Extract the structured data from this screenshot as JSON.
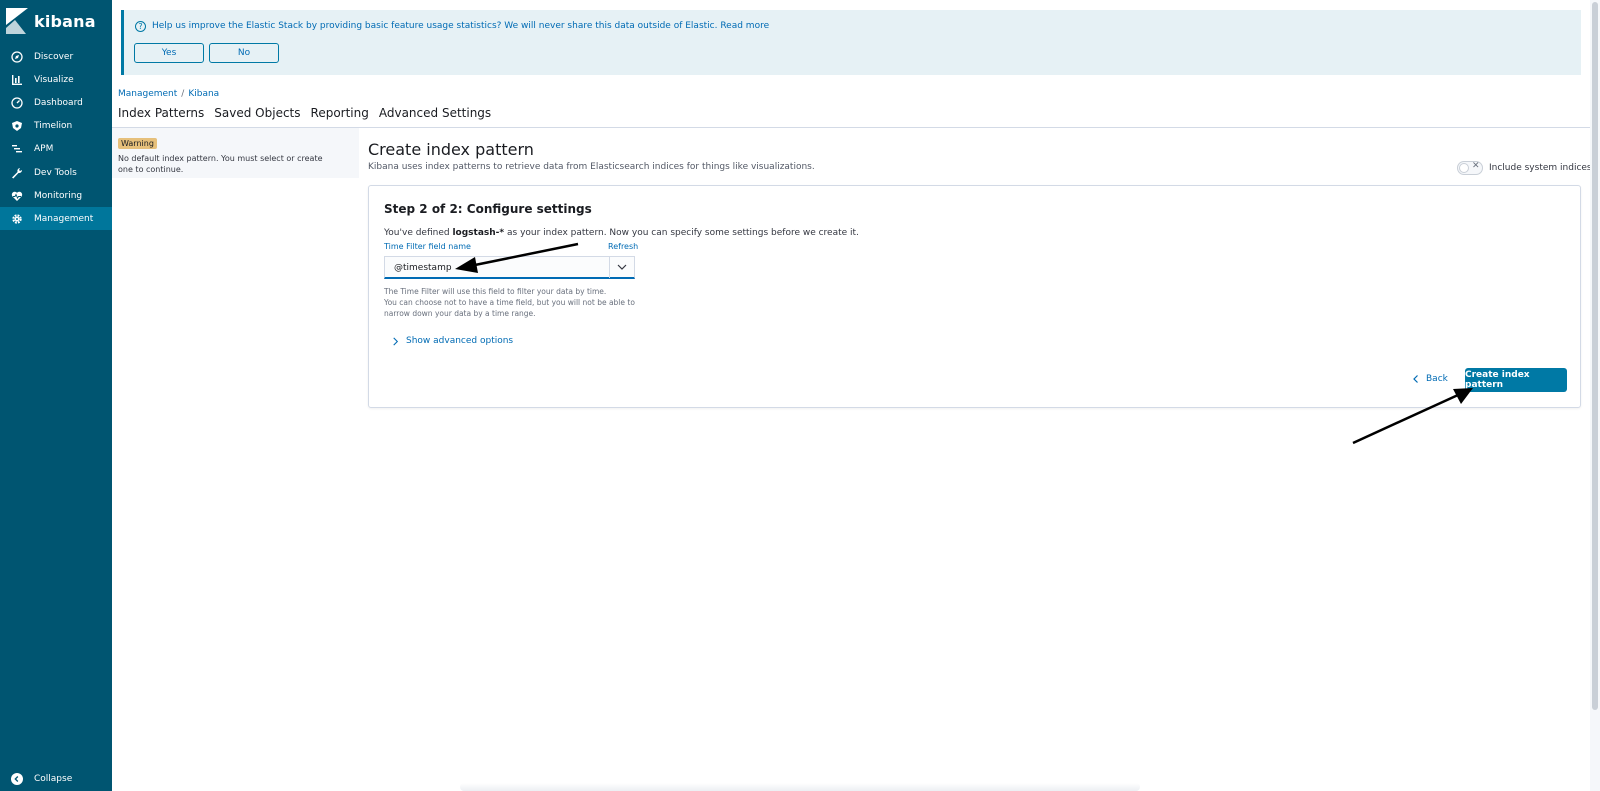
{
  "app": {
    "name": "kibana"
  },
  "sidebar": {
    "items": [
      {
        "label": "Discover",
        "icon": "compass-icon"
      },
      {
        "label": "Visualize",
        "icon": "bar-chart-icon"
      },
      {
        "label": "Dashboard",
        "icon": "dashboard-icon"
      },
      {
        "label": "Timelion",
        "icon": "shield-icon"
      },
      {
        "label": "APM",
        "icon": "apm-icon"
      },
      {
        "label": "Dev Tools",
        "icon": "wrench-icon"
      },
      {
        "label": "Monitoring",
        "icon": "heartbeat-icon"
      },
      {
        "label": "Management",
        "icon": "gear-icon",
        "active": true
      }
    ],
    "collapse_label": "Collapse"
  },
  "banner": {
    "message": "Help us improve the Elastic Stack by providing basic feature usage statistics? We will never share this data outside of Elastic. Read more",
    "yes_label": "Yes",
    "no_label": "No"
  },
  "breadcrumbs": {
    "first": "Management",
    "separator": "/",
    "second": "Kibana"
  },
  "tabs": [
    "Index Patterns",
    "Saved Objects",
    "Reporting",
    "Advanced Settings"
  ],
  "warning": {
    "badge": "Warning",
    "text": "No default index pattern. You must select or create one to continue."
  },
  "main": {
    "title": "Create index pattern",
    "subtitle": "Kibana uses index patterns to retrieve data from Elasticsearch indices for things like visualizations.",
    "include_system_indices_label": "Include system indices",
    "include_system_indices_on": false
  },
  "step": {
    "title": "Step 2 of 2: Configure settings",
    "desc_prefix": "You've defined",
    "pattern": "logstash-*",
    "desc_suffix": "as your index pattern. Now you can specify some settings before we create it.",
    "field_label": "Time Filter field name",
    "refresh_label": "Refresh",
    "selected_value": "@timestamp",
    "help_line1": "The Time Filter will use this field to filter your data by time.",
    "help_line2": "You can choose not to have a time field, but you will not be able to",
    "help_line3": "narrow down your data by a time range.",
    "advanced_label": "Show advanced options",
    "back_label": "Back",
    "create_label": "Create index pattern"
  },
  "colors": {
    "sidebar_bg": "#005571",
    "sidebar_active": "#00769b",
    "accent": "#0079a5",
    "link": "#006bb4",
    "warning": "#e6c07b"
  }
}
